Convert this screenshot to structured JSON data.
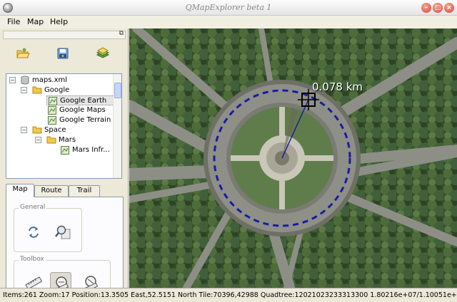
{
  "window": {
    "title": "QMapExplorer beta 1"
  },
  "menu": {
    "items": [
      "File",
      "Map",
      "Help"
    ]
  },
  "toolbar": {
    "icons": [
      "open-folder-icon",
      "save-icon",
      "layers-icon"
    ]
  },
  "tree": {
    "items": [
      {
        "label": "maps.xml",
        "icon": "database-icon",
        "expander": "−"
      },
      {
        "label": "Google",
        "icon": "folder-icon",
        "expander": "−"
      },
      {
        "label": "Google Earth",
        "icon": "map-icon",
        "selected": true
      },
      {
        "label": "Google Maps",
        "icon": "map-icon"
      },
      {
        "label": "Google Terrain",
        "icon": "map-icon"
      },
      {
        "label": "Space",
        "icon": "folder-icon",
        "expander": "−"
      },
      {
        "label": "Mars",
        "icon": "folder-icon",
        "expander": "−"
      },
      {
        "label": "Mars Infr...",
        "icon": "map-icon"
      }
    ]
  },
  "tabs": {
    "items": [
      "Map",
      "Route",
      "Trail"
    ],
    "active": "Map"
  },
  "map_tab": {
    "general_label": "General",
    "toolbox_label": "Toolbox"
  },
  "map": {
    "scale_label": "0.078 km"
  },
  "status": {
    "text": "Items:261  Zoom:17  Position:13.3505 East,52.5151 North  Tile:70396,42988  Quadtree:12021023233313300  1.80216e+07/1.10051e+07"
  },
  "colors": {
    "measure_circle": "#1a1aa8",
    "tree_border": "#7f9db9"
  }
}
